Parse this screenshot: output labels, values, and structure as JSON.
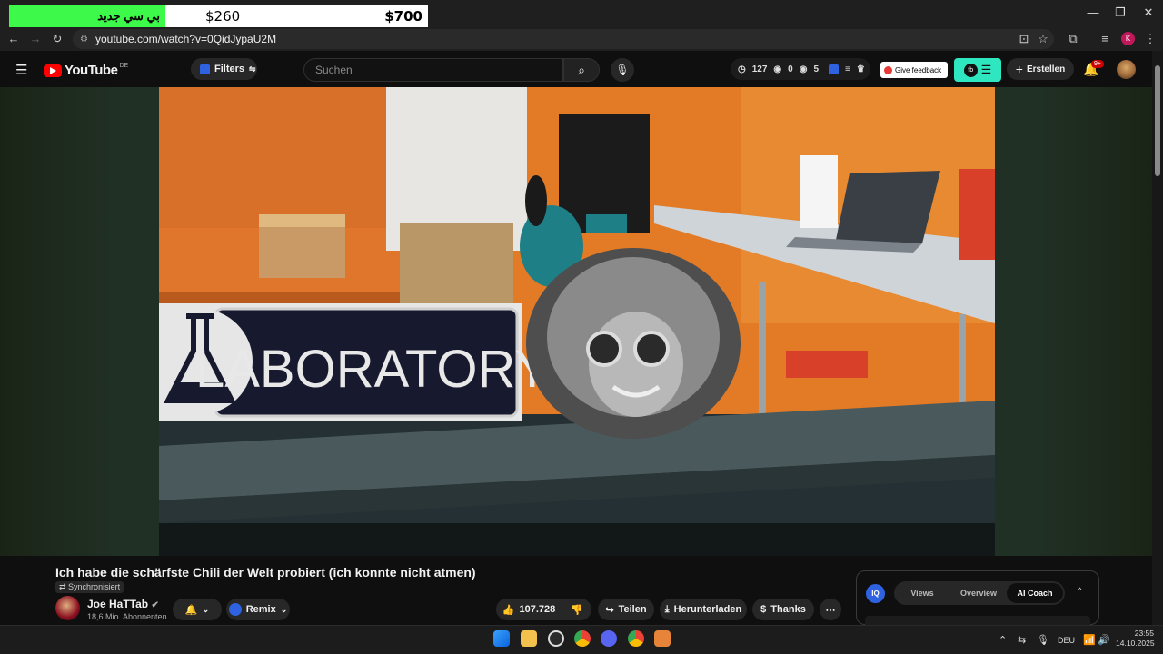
{
  "browser": {
    "promo": {
      "arabic": "بي سي جديد",
      "price_left": "$260",
      "price_right": "$700"
    },
    "window_controls": {
      "minimize": "—",
      "restore": "❐",
      "close": "✕"
    },
    "url": "youtube.com/watch?v=0QidJypaU2M",
    "profile_initial": "K"
  },
  "masthead": {
    "logo_text": "YouTube",
    "region": "DE",
    "filters_label": "Filters",
    "search_placeholder": "Suchen",
    "stats": {
      "views": "127",
      "likes": "0",
      "other": "5"
    },
    "feedback_label": "Give feedback",
    "create_label": "Erstellen",
    "notification_count": "9+"
  },
  "video": {
    "sign_text": "LABORATORY",
    "title": "Ich habe die schärfste Chili der Welt probiert (ich konnte nicht atmen)",
    "sync_label": "Synchronisiert",
    "channel": {
      "name": "Joe HaTTab",
      "subscribers": "18,6 Mio. Abonnenten"
    },
    "actions": {
      "remix": "Remix",
      "likes": "107.728",
      "share": "Teilen",
      "download": "Herunterladen",
      "thanks": "Thanks",
      "more": "⋯"
    }
  },
  "side_panel": {
    "logo": "IQ",
    "tabs": [
      "Views",
      "Overview",
      "AI Coach"
    ],
    "active_tab": "AI Coach"
  },
  "taskbar": {
    "language": "DEU",
    "time": "23:55",
    "date": "14.10.2025"
  },
  "colors": {
    "promo_green": "#3cf94a",
    "youtube_red": "#ff0000",
    "extension_teal": "#2ee6c0",
    "iq_blue": "#2e62e0"
  }
}
